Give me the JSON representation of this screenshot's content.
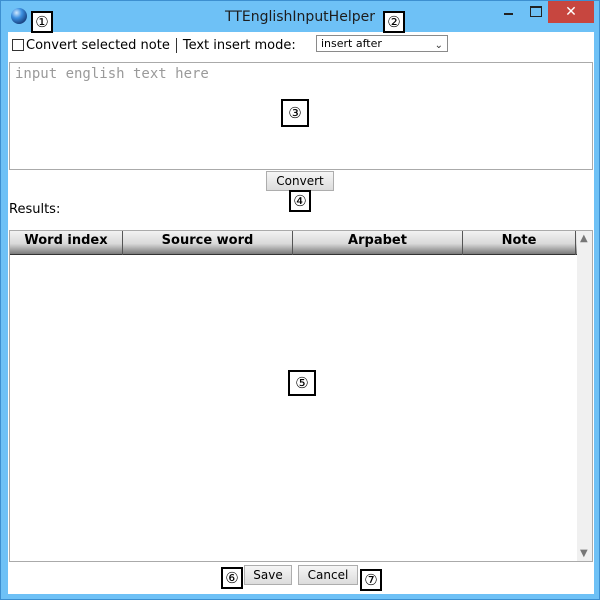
{
  "window": {
    "title": "TTEnglishInputHelper",
    "close_glyph": "✕"
  },
  "options": {
    "convert_selected_label": "Convert selected note",
    "text_insert_mode_label": "Text insert mode:",
    "insert_mode_value": "insert after",
    "convert_selected_checked": false
  },
  "input": {
    "placeholder": "input english text here"
  },
  "actions": {
    "convert": "Convert",
    "save": "Save",
    "cancel": "Cancel"
  },
  "results": {
    "label": "Results:",
    "columns": [
      "Word index",
      "Source word",
      "Arpabet",
      "Note"
    ],
    "rows": []
  },
  "callouts": [
    "①",
    "②",
    "③",
    "④",
    "⑤",
    "⑥",
    "⑦"
  ],
  "colors": {
    "title_bar": "#6ec1f6",
    "close_button": "#c7463f"
  }
}
